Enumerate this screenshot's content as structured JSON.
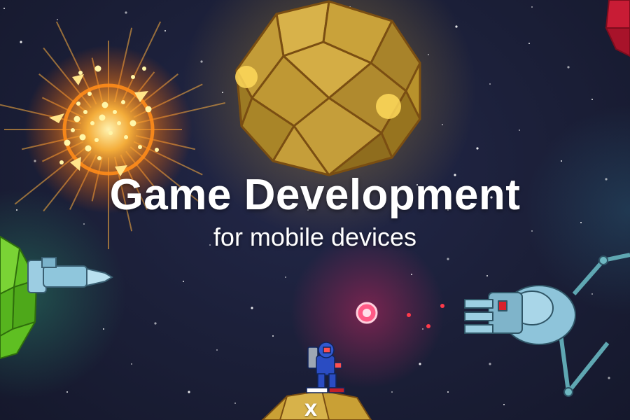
{
  "title": "Game Development",
  "subtitle": "for mobile devices",
  "planet_marker": "X",
  "colors": {
    "background": "#1b1f38",
    "title_text": "#ffffff",
    "gold_planet": "#c9a035",
    "explosion": "#ff9a1f",
    "green_planet": "#5fbf22",
    "turret": "#8fc6dc",
    "enemy_orb": "#ff5a86",
    "red_planet": "#d8203a"
  },
  "icons": [
    "gold-planet-icon",
    "explosion-icon",
    "green-planet-icon",
    "turret-icon",
    "enemy-orb-icon",
    "robot-turret-icon",
    "astronaut-icon",
    "red-planet-icon"
  ]
}
